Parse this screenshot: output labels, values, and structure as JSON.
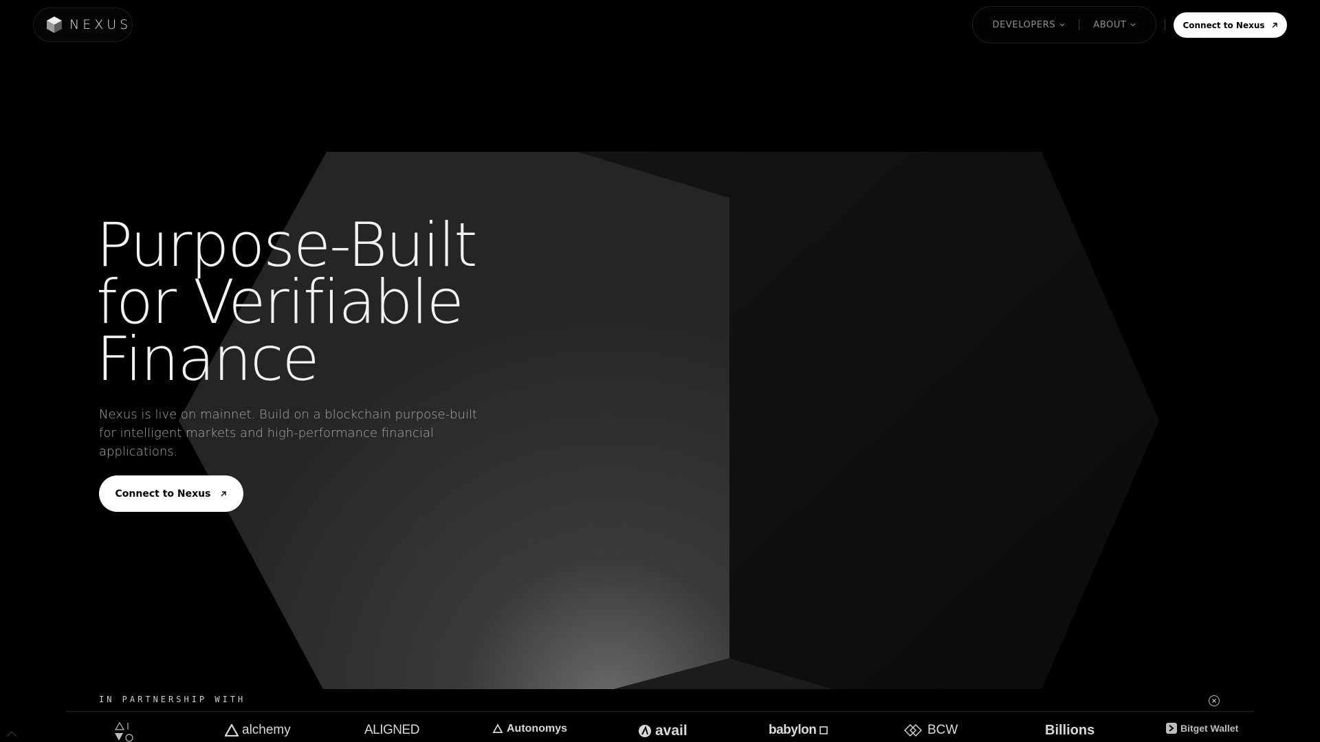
{
  "header": {
    "brand": "NEXUS",
    "nav": [
      {
        "label": "DEVELOPERS"
      },
      {
        "label": "ABOUT"
      }
    ],
    "cta_label": "Connect to Nexus"
  },
  "hero": {
    "title_lines": [
      "Purpose-Built",
      "for Verifiable",
      "Finance"
    ],
    "subtitle": "Nexus is live on mainnet. Build on a blockchain purpose-built for intelligent markets and high-performance financial applications.",
    "cta_label": "Connect to Nexus"
  },
  "partners": {
    "label": "IN PARTNERSHIP WITH",
    "logos": [
      "alchemy",
      "ALIGNED",
      "Autonomys",
      "avail",
      "babylon",
      "BCW",
      "Billions",
      "Bitget Wallet"
    ]
  },
  "icons": {
    "brand": "cube-icon",
    "nav_chevron": "chevron-down-icon",
    "cta_arrow": "arrow-up-right-icon",
    "close": "close-icon"
  },
  "colors": {
    "background": "#000000",
    "hex_panel_left": "#2a2a2c",
    "hex_panel_right": "#111111",
    "cta_background": "#ffffff",
    "cta_text": "#000000"
  }
}
